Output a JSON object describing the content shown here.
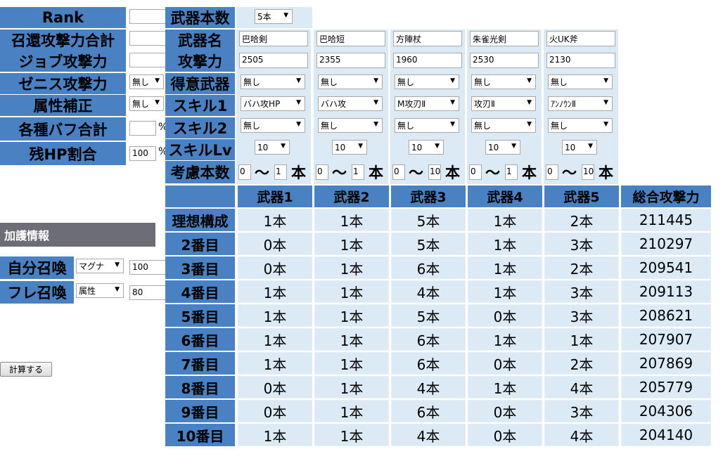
{
  "left": {
    "rank_label": "Rank",
    "summon_total_label": "召還攻撃力合計",
    "job_label": "ジョブ攻撃力",
    "zenith_label": "ゼニス攻撃力",
    "zenith_select": "無し",
    "element_label": "属性補正",
    "element_select": "無し",
    "buff_label": "各種バフ合計",
    "buff_unit": "%",
    "hp_label": "残HP割合",
    "hp_value": "100",
    "hp_unit": "%",
    "kago_title": "加護情報",
    "own_summon_label": "自分召喚",
    "own_summon_select": "マグナ",
    "own_summon_value": "100",
    "friend_summon_label": "フレ召喚",
    "friend_summon_select": "属性",
    "friend_summon_value": "80",
    "calc_button": "計算する"
  },
  "config": {
    "weapon_count_label": "武器本数",
    "weapon_count_select": "5本",
    "name_label": "武器名",
    "attack_label": "攻撃力",
    "favorite_label": "得意武器",
    "skill1_label": "スキル1",
    "skill2_label": "スキル2",
    "skilllv_label": "スキルLv",
    "range_label": "考慮本数",
    "tilde": "〜",
    "hon": "本",
    "weapons": [
      {
        "name": "巴哈剣",
        "attack": "2505",
        "favorite": "無し",
        "skill1": "バハ攻HP",
        "skill2": "無し",
        "lv": "10",
        "min": "0",
        "max": "1"
      },
      {
        "name": "巴哈短",
        "attack": "2355",
        "favorite": "無し",
        "skill1": "バハ攻",
        "skill2": "無し",
        "lv": "10",
        "min": "0",
        "max": "1"
      },
      {
        "name": "方陣杖",
        "attack": "1960",
        "favorite": "無し",
        "skill1": "M攻刃Ⅱ",
        "skill2": "無し",
        "lv": "10",
        "min": "0",
        "max": "10"
      },
      {
        "name": "朱雀光剣",
        "attack": "2530",
        "favorite": "無し",
        "skill1": "攻刃Ⅱ",
        "skill2": "無し",
        "lv": "10",
        "min": "0",
        "max": "1"
      },
      {
        "name": "火UK斧",
        "attack": "2130",
        "favorite": "無し",
        "skill1": "ｱﾝﾉｳﾝⅡ",
        "skill2": "無し",
        "lv": "10",
        "min": "0",
        "max": "10"
      }
    ]
  },
  "results": {
    "headers": [
      "武器1",
      "武器2",
      "武器3",
      "武器4",
      "武器5",
      "総合攻撃力"
    ],
    "rows": [
      {
        "label": "理想構成",
        "cells": [
          "1本",
          "1本",
          "5本",
          "1本",
          "2本",
          "211445"
        ]
      },
      {
        "label": "2番目",
        "cells": [
          "0本",
          "1本",
          "5本",
          "1本",
          "3本",
          "210297"
        ]
      },
      {
        "label": "3番目",
        "cells": [
          "0本",
          "1本",
          "6本",
          "1本",
          "2本",
          "209541"
        ]
      },
      {
        "label": "4番目",
        "cells": [
          "1本",
          "1本",
          "4本",
          "1本",
          "3本",
          "209113"
        ]
      },
      {
        "label": "5番目",
        "cells": [
          "1本",
          "1本",
          "5本",
          "0本",
          "3本",
          "208621"
        ]
      },
      {
        "label": "6番目",
        "cells": [
          "1本",
          "1本",
          "6本",
          "1本",
          "1本",
          "207907"
        ]
      },
      {
        "label": "7番目",
        "cells": [
          "1本",
          "1本",
          "6本",
          "0本",
          "2本",
          "207869"
        ]
      },
      {
        "label": "8番目",
        "cells": [
          "0本",
          "1本",
          "4本",
          "1本",
          "4本",
          "205779"
        ]
      },
      {
        "label": "9番目",
        "cells": [
          "0本",
          "1本",
          "6本",
          "0本",
          "3本",
          "204306"
        ]
      },
      {
        "label": "10番目",
        "cells": [
          "1本",
          "1本",
          "4本",
          "0本",
          "4本",
          "204140"
        ]
      }
    ]
  },
  "colors": {
    "header_blue": "#4a81c3",
    "cell_blue": "#dceaf5",
    "kago_gray": "#6d6d78"
  },
  "icons": {
    "dropdown": "dropdown-arrow-icon"
  }
}
